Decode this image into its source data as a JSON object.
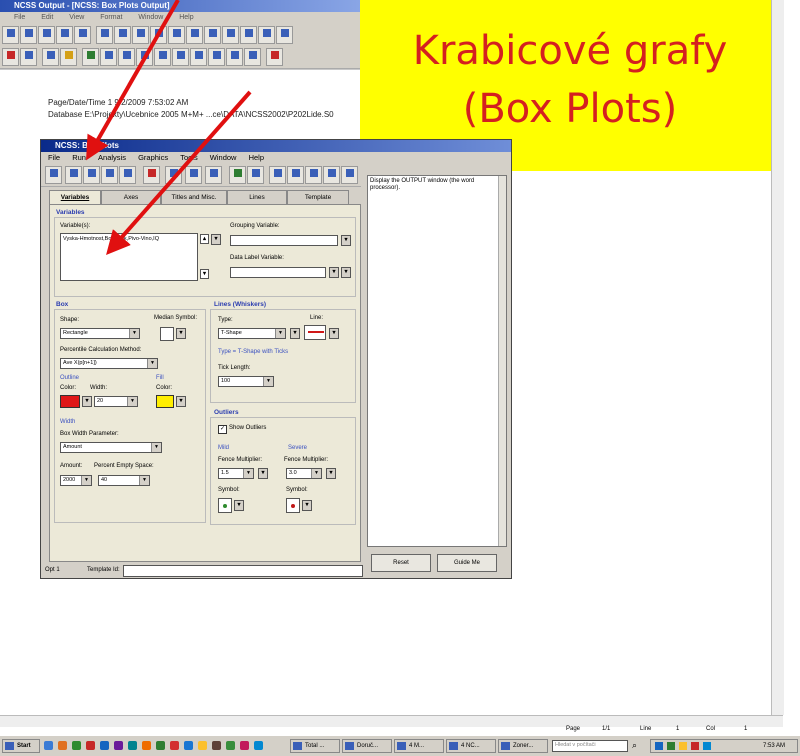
{
  "output_window": {
    "title": "NCSS Output - [NCSS: Box Plots Output]",
    "menu": [
      "File",
      "Edit",
      "View",
      "Format",
      "Window",
      "Help"
    ],
    "page_line": "Page/Date/Time     1   9/2/2009 7:53:02 AM",
    "database_line": "Database     E:\\Projekty\\Ucebnice 2005 M+M+ ...ce\\DATA\\NCSS2002\\P202Lide.S0"
  },
  "banner": {
    "line1": "Krabicové grafy",
    "line2": "(Box Plots)",
    "text_color": "#d42020",
    "bg_color": "#ffff00"
  },
  "dialog": {
    "title": "NCSS: Box Plots",
    "menu": [
      "File",
      "Run",
      "Analysis",
      "Graphics",
      "Tools",
      "Window",
      "Help"
    ],
    "tabs": [
      "Variables",
      "Axes",
      "Titles and Misc.",
      "Lines",
      "Template"
    ],
    "variables": {
      "header": "Variables",
      "label": "Variable(s):",
      "value": "Vyska-Hmotnost,Boty-Vek,Pivo-Vino,IQ",
      "grouping_label": "Grouping Variable:",
      "data_label_label": "Data Label Variable:"
    },
    "box": {
      "header": "Box",
      "shape_label": "Shape:",
      "shape_value": "Rectangle",
      "median_label": "Median Symbol:",
      "percentile_label": "Percentile Calculation Method:",
      "percentile_value": "Ave X(p[n+1])",
      "outline_label": "Outline",
      "fill_label": "Fill",
      "color_label": "Color:",
      "width_label": "Width:",
      "width_value": "20",
      "outline_color": "#e01818",
      "fill_color": "#ffee00",
      "fill_color_label": "Color:",
      "width_section": "Width",
      "box_width_param_label": "Box Width Parameter:",
      "box_width_param_value": "Amount",
      "amount_label": "Amount:",
      "amount_value": "2000",
      "empty_space_label": "Percent Empty Space:",
      "empty_space_value": "40"
    },
    "lines": {
      "header": "Lines (Whiskers)",
      "type_label": "Type:",
      "type_value": "T-Shape",
      "line_label": "Line:",
      "note": "Type = T-Shape with Ticks",
      "tick_length_label": "Tick Length:",
      "tick_length_value": "100"
    },
    "outliers": {
      "header": "Outliers",
      "show_label": "Show Outliers",
      "show_checked": true,
      "mild_label": "Mild",
      "severe_label": "Severe",
      "fence_label": "Fence Multiplier:",
      "mild_fence": "1.5",
      "severe_fence": "3.0",
      "symbol_label": "Symbol:",
      "mild_symbol_color": "#2e8b2e",
      "severe_symbol_color": "#c01818"
    },
    "help_text": "Display the OUTPUT window (the word processor).",
    "reset_label": "Reset",
    "guide_label": "Guide Me",
    "footer_opt": "Opt 1",
    "footer_template": "Template Id:"
  },
  "status_bar": {
    "page_label": "Page",
    "page_value": "1/1",
    "line_label": "Line",
    "line_value": "1",
    "col_label": "Col",
    "col_value": "1"
  },
  "taskbar": {
    "start": "Start",
    "tasks": [
      "Total ...",
      "Doruč...",
      "4 M...",
      "4 NC...",
      "Zoner..."
    ],
    "search_placeholder": "Hledat v počítači",
    "clock": "7:53 AM"
  },
  "arrow_color": "#e01010"
}
